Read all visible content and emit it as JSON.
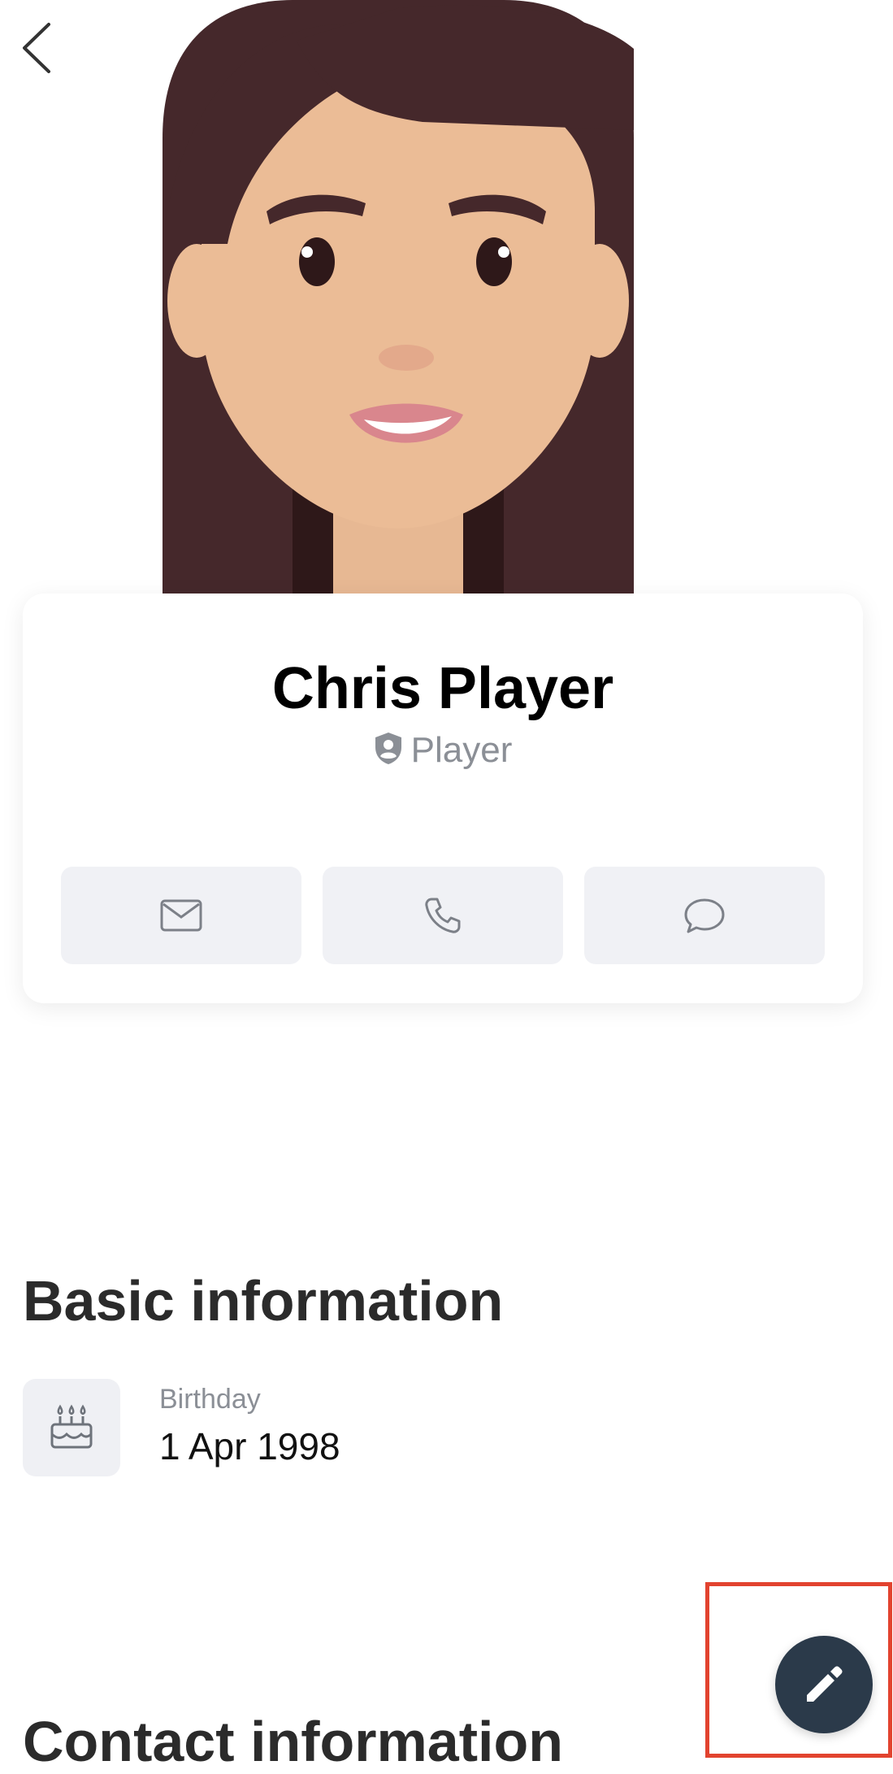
{
  "header": {
    "back_icon": "chevron-left-icon"
  },
  "profile": {
    "name": "Chris Player",
    "role": "Player",
    "role_icon": "shield-user-icon",
    "avatar": "female-avatar-illustration"
  },
  "actions": [
    {
      "icon": "mail-icon"
    },
    {
      "icon": "phone-icon"
    },
    {
      "icon": "chat-bubble-icon"
    }
  ],
  "basic_information": {
    "title": "Basic information",
    "items": [
      {
        "icon": "birthday-cake-icon",
        "label": "Birthday",
        "value": "1 Apr 1998"
      }
    ]
  },
  "next_section": {
    "title": "Contact information"
  },
  "fab": {
    "icon": "pencil-icon",
    "highlight_color": "#e2432f",
    "color": "#2b3a4a"
  }
}
